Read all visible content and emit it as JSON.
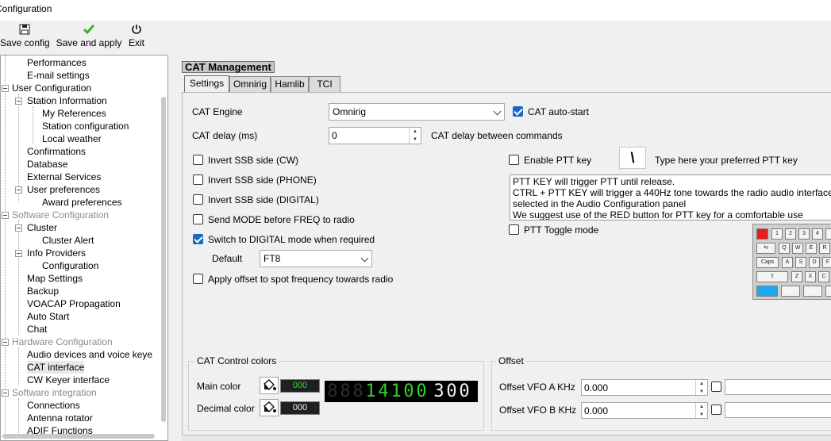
{
  "window": {
    "title": "Configuration"
  },
  "toolbar": {
    "save_config": "Save config",
    "save_apply": "Save and apply",
    "exit": "Exit"
  },
  "tree": {
    "items": [
      "Performances",
      "E-mail settings",
      "User Configuration",
      "Station Information",
      "My References",
      "Station configuration",
      "Local weather",
      "Confirmations",
      "Database",
      "External Services",
      "User preferences",
      "Award preferences",
      "Software Configuration",
      "Cluster",
      "Cluster Alert",
      "Info Providers",
      "Configuration",
      "Map Settings",
      "Backup",
      "VOACAP Propagation",
      "Auto Start",
      "Chat",
      "Hardware Configuration",
      "Audio devices and voice keye",
      "CAT interface",
      "CW Keyer interface",
      "Software integration",
      "Connections",
      "Antenna rotator",
      "ADIF Functions"
    ]
  },
  "panel": {
    "title": "CAT Management",
    "tabs": [
      "Settings",
      "Omnirig",
      "Hamlib",
      "TCI"
    ]
  },
  "settings": {
    "cat_engine_label": "CAT Engine",
    "cat_engine_value": "Omnirig",
    "cat_autostart": "CAT auto-start",
    "cat_delay_label": "CAT delay (ms)",
    "cat_delay_value": "0",
    "cat_delay_desc": "CAT delay between commands",
    "invert_cw": "Invert SSB side (CW)",
    "invert_phone": "Invert SSB side (PHONE)",
    "invert_digital": "Invert SSB side (DIGITAL)",
    "send_mode": "Send MODE before FREQ to radio",
    "switch_digital": "Switch to DIGITAL mode when required",
    "default_label": "Default",
    "default_value": "FT8",
    "apply_offset": "Apply offset to spot frequency towards radio",
    "enable_ptt": "Enable PTT key",
    "ptt_key_value": "\\",
    "ptt_key_hint": "Type here your preferred PTT key",
    "ptt_info": [
      "PTT KEY will trigger PTT until release.",
      "CTRL + PTT KEY will trigger a 440Hz tone towards the radio audio interface",
      "selected in the Audio Configuration panel",
      "We suggest use of the RED button for PTT key for a comfortable use"
    ],
    "ptt_toggle": "PTT Toggle mode"
  },
  "keyboard": {
    "keys_row1": [
      "1",
      "2",
      "3",
      "4"
    ],
    "keys_row2": [
      "Q",
      "W",
      "E",
      "R"
    ],
    "keys_row3": [
      "Caps",
      "A",
      "S",
      "D",
      "F"
    ],
    "keys_row4": [
      "Z",
      "X",
      "C"
    ]
  },
  "cat_colors": {
    "title": "CAT Control colors",
    "main_label": "Main color",
    "main_value": "000",
    "decimal_label": "Decimal color",
    "decimal_value": "000",
    "frequency_display": "14100300"
  },
  "offset": {
    "title": "Offset",
    "vfo_a_label": "Offset VFO A KHz",
    "vfo_a_value": "0.000",
    "vfo_b_label": "Offset VFO B KHz",
    "vfo_b_value": "0.000"
  }
}
